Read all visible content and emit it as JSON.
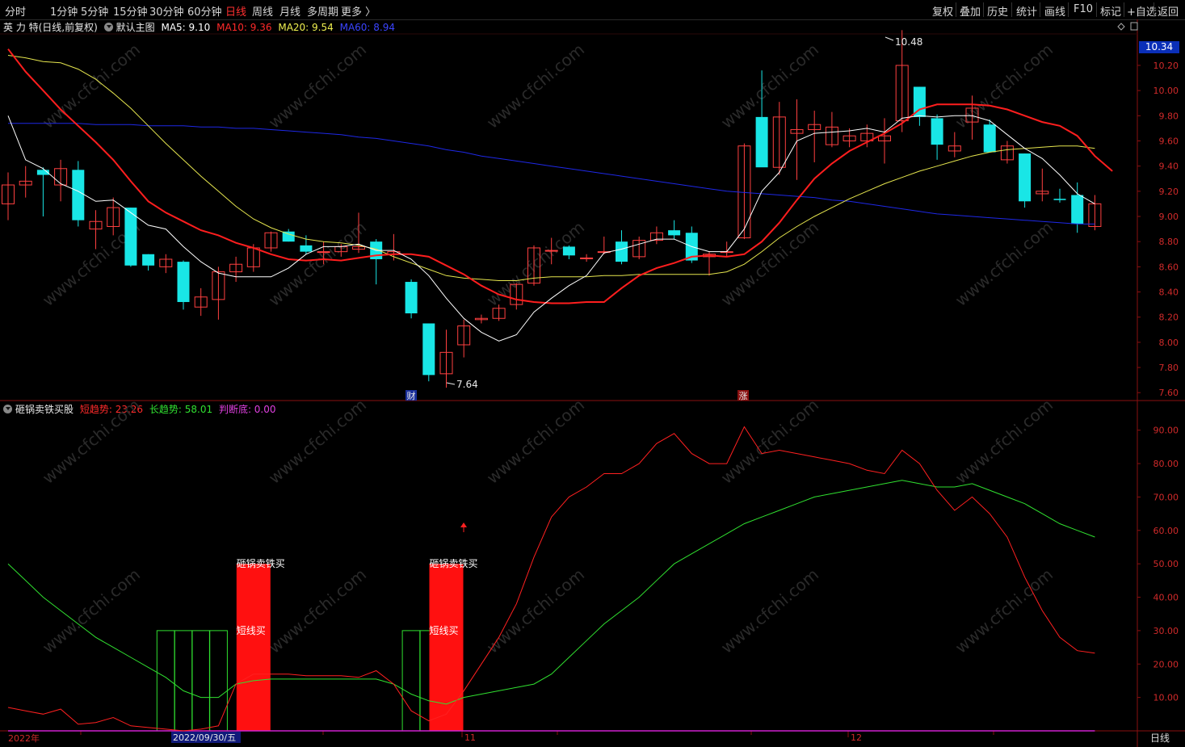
{
  "toolbar": {
    "periods": [
      "分时",
      "1分钟",
      "5分钟",
      "15分钟",
      "30分钟",
      "60分钟",
      "日线",
      "周线",
      "月线",
      "多周期",
      "更多 〉"
    ],
    "active_period": "日线",
    "right_buttons": [
      "复权",
      "叠加",
      "历史",
      "统计",
      "画线",
      "F10",
      "标记",
      "+自选",
      "返回"
    ]
  },
  "main_legend": {
    "stock": "英 力 特(日线,前复权)",
    "template": "默认主图",
    "ma5_label": "MA5: 9.10",
    "ma10_label": "MA10: 9.36",
    "ma20_label": "MA20: 9.54",
    "ma60_label": "MA60: 8.94"
  },
  "indicator_legend": {
    "name": "砸锅卖铁买股",
    "short_label": "短趋势: 23.26",
    "long_label": "长趋势: 58.01",
    "judge_label": "判断底: 0.00"
  },
  "current_price": "10.34",
  "price_axis": [
    "10.20",
    "10.00",
    "9.80",
    "9.60",
    "9.40",
    "9.20",
    "9.00",
    "8.80",
    "8.60",
    "8.40",
    "8.20",
    "8.00",
    "7.80",
    "7.60"
  ],
  "indicator_axis": [
    "90.00",
    "80.00",
    "70.00",
    "60.00",
    "50.00",
    "40.00",
    "30.00",
    "20.00",
    "10.00"
  ],
  "date_axis": {
    "year_label": "2022年",
    "selected_date": "2022/09/30/五",
    "month_11": "11",
    "month_12": "12",
    "period": "日线"
  },
  "annotations": {
    "high": "10.48",
    "low": "7.64",
    "marker_cai": "财",
    "marker_zhang": "涨",
    "signal1_title": "砸锅卖铁买",
    "signal1_sub": "短线买",
    "signal2_title": "砸锅卖铁买",
    "signal2_sub": "短线买",
    "watermark": "www.cfchi.com"
  },
  "colors": {
    "up": "#ff4040",
    "down": "#19e6e6",
    "ma5": "#ffffff",
    "ma10": "#ff1e1e",
    "ma20": "#e6e64e",
    "ma60": "#1e28e6",
    "short_trend": "#ff2020",
    "long_trend": "#30e030",
    "judge": "#d020d0"
  },
  "chart_data": [
    {
      "type": "candlestick",
      "title": "英 力 特(日线,前复权)",
      "ylim": [
        7.55,
        10.45
      ],
      "candles": [
        {
          "o": 9.1,
          "h": 9.35,
          "l": 8.97,
          "c": 9.25
        },
        {
          "o": 9.25,
          "h": 9.4,
          "l": 9.15,
          "c": 9.28
        },
        {
          "o": 9.37,
          "h": 9.39,
          "l": 9.0,
          "c": 9.33
        },
        {
          "o": 9.25,
          "h": 9.45,
          "l": 9.12,
          "c": 9.38
        },
        {
          "o": 9.37,
          "h": 9.44,
          "l": 8.92,
          "c": 8.97
        },
        {
          "o": 8.9,
          "h": 9.05,
          "l": 8.74,
          "c": 8.96
        },
        {
          "o": 8.92,
          "h": 9.15,
          "l": 8.85,
          "c": 9.07
        },
        {
          "o": 9.07,
          "h": 9.07,
          "l": 8.6,
          "c": 8.61
        },
        {
          "o": 8.7,
          "h": 8.7,
          "l": 8.57,
          "c": 8.61
        },
        {
          "o": 8.6,
          "h": 8.7,
          "l": 8.55,
          "c": 8.66
        },
        {
          "o": 8.64,
          "h": 8.65,
          "l": 8.26,
          "c": 8.32
        },
        {
          "o": 8.28,
          "h": 8.43,
          "l": 8.21,
          "c": 8.36
        },
        {
          "o": 8.34,
          "h": 8.6,
          "l": 8.18,
          "c": 8.56
        },
        {
          "o": 8.56,
          "h": 8.68,
          "l": 8.48,
          "c": 8.62
        },
        {
          "o": 8.6,
          "h": 8.78,
          "l": 8.56,
          "c": 8.75
        },
        {
          "o": 8.75,
          "h": 8.88,
          "l": 8.72,
          "c": 8.87
        },
        {
          "o": 8.88,
          "h": 8.9,
          "l": 8.8,
          "c": 8.8
        },
        {
          "o": 8.77,
          "h": 8.85,
          "l": 8.7,
          "c": 8.72
        },
        {
          "o": 8.72,
          "h": 8.8,
          "l": 8.62,
          "c": 8.72
        },
        {
          "o": 8.72,
          "h": 8.78,
          "l": 8.68,
          "c": 8.76
        },
        {
          "o": 8.74,
          "h": 9.03,
          "l": 8.71,
          "c": 8.76
        },
        {
          "o": 8.8,
          "h": 8.82,
          "l": 8.46,
          "c": 8.66
        },
        {
          "o": 8.7,
          "h": 8.86,
          "l": 8.65,
          "c": 8.72
        },
        {
          "o": 8.48,
          "h": 8.5,
          "l": 8.19,
          "c": 8.23
        },
        {
          "o": 8.15,
          "h": 8.15,
          "l": 7.69,
          "c": 7.74
        },
        {
          "o": 7.75,
          "h": 8.1,
          "l": 7.64,
          "c": 7.92
        },
        {
          "o": 7.98,
          "h": 8.18,
          "l": 7.88,
          "c": 8.13
        },
        {
          "o": 8.18,
          "h": 8.22,
          "l": 8.15,
          "c": 8.19
        },
        {
          "o": 8.19,
          "h": 8.3,
          "l": 8.17,
          "c": 8.27
        },
        {
          "o": 8.3,
          "h": 8.47,
          "l": 8.26,
          "c": 8.46
        },
        {
          "o": 8.47,
          "h": 8.77,
          "l": 8.45,
          "c": 8.75
        },
        {
          "o": 8.73,
          "h": 8.83,
          "l": 8.62,
          "c": 8.73
        },
        {
          "o": 8.76,
          "h": 8.77,
          "l": 8.66,
          "c": 8.69
        },
        {
          "o": 8.67,
          "h": 8.7,
          "l": 8.64,
          "c": 8.67
        },
        {
          "o": 8.72,
          "h": 8.84,
          "l": 8.7,
          "c": 8.72
        },
        {
          "o": 8.8,
          "h": 8.89,
          "l": 8.62,
          "c": 8.64
        },
        {
          "o": 8.68,
          "h": 8.84,
          "l": 8.66,
          "c": 8.81
        },
        {
          "o": 8.81,
          "h": 8.92,
          "l": 8.78,
          "c": 8.87
        },
        {
          "o": 8.89,
          "h": 8.97,
          "l": 8.82,
          "c": 8.85
        },
        {
          "o": 8.87,
          "h": 8.92,
          "l": 8.63,
          "c": 8.65
        },
        {
          "o": 8.68,
          "h": 8.72,
          "l": 8.53,
          "c": 8.7
        },
        {
          "o": 8.72,
          "h": 8.8,
          "l": 8.68,
          "c": 8.72
        },
        {
          "o": 8.83,
          "h": 9.58,
          "l": 8.82,
          "c": 9.56
        },
        {
          "o": 9.79,
          "h": 10.16,
          "l": 9.41,
          "c": 9.39
        },
        {
          "o": 9.39,
          "h": 9.91,
          "l": 9.33,
          "c": 9.79
        },
        {
          "o": 9.66,
          "h": 9.93,
          "l": 9.29,
          "c": 9.69
        },
        {
          "o": 9.69,
          "h": 9.84,
          "l": 9.43,
          "c": 9.73
        },
        {
          "o": 9.57,
          "h": 9.83,
          "l": 9.55,
          "c": 9.71
        },
        {
          "o": 9.6,
          "h": 9.7,
          "l": 9.55,
          "c": 9.64
        },
        {
          "o": 9.6,
          "h": 9.73,
          "l": 9.55,
          "c": 9.66
        },
        {
          "o": 9.6,
          "h": 9.78,
          "l": 9.42,
          "c": 9.64
        },
        {
          "o": 9.76,
          "h": 10.48,
          "l": 9.67,
          "c": 10.2
        },
        {
          "o": 10.03,
          "h": 10.03,
          "l": 9.72,
          "c": 9.79
        },
        {
          "o": 9.78,
          "h": 9.81,
          "l": 9.45,
          "c": 9.57
        },
        {
          "o": 9.52,
          "h": 9.67,
          "l": 9.47,
          "c": 9.56
        },
        {
          "o": 9.75,
          "h": 9.96,
          "l": 9.61,
          "c": 9.86
        },
        {
          "o": 9.73,
          "h": 9.77,
          "l": 9.51,
          "c": 9.51
        },
        {
          "o": 9.45,
          "h": 9.6,
          "l": 9.42,
          "c": 9.56
        },
        {
          "o": 9.5,
          "h": 9.5,
          "l": 9.07,
          "c": 9.12
        },
        {
          "o": 9.18,
          "h": 9.38,
          "l": 9.12,
          "c": 9.2
        },
        {
          "o": 9.14,
          "h": 9.22,
          "l": 9.11,
          "c": 9.13
        },
        {
          "o": 9.17,
          "h": 9.27,
          "l": 8.87,
          "c": 8.94
        },
        {
          "o": 8.92,
          "h": 9.17,
          "l": 8.89,
          "c": 9.1
        }
      ],
      "ma5": [
        9.8,
        9.45,
        9.38,
        9.26,
        9.2,
        9.12,
        9.13,
        9.03,
        8.93,
        8.9,
        8.76,
        8.64,
        8.55,
        8.52,
        8.52,
        8.52,
        8.59,
        8.7,
        8.76,
        8.76,
        8.78,
        8.73,
        8.73,
        8.66,
        8.53,
        8.35,
        8.19,
        8.08,
        8.01,
        8.06,
        8.24,
        8.35,
        8.45,
        8.53,
        8.71,
        8.74,
        8.78,
        8.82,
        8.82,
        8.76,
        8.72,
        8.72,
        8.9,
        9.2,
        9.35,
        9.6,
        9.66,
        9.67,
        9.68,
        9.7,
        9.67,
        9.78,
        9.8,
        9.79,
        9.8,
        9.8,
        9.76,
        9.65,
        9.54,
        9.46,
        9.33,
        9.18,
        9.1
      ],
      "ma10": [
        10.33,
        10.15,
        10.0,
        9.85,
        9.72,
        9.59,
        9.45,
        9.28,
        9.12,
        9.03,
        8.96,
        8.89,
        8.85,
        8.79,
        8.75,
        8.7,
        8.66,
        8.65,
        8.66,
        8.65,
        8.67,
        8.69,
        8.7,
        8.7,
        8.68,
        8.61,
        8.54,
        8.45,
        8.38,
        8.34,
        8.32,
        8.31,
        8.31,
        8.32,
        8.32,
        8.43,
        8.53,
        8.59,
        8.63,
        8.68,
        8.69,
        8.68,
        8.7,
        8.8,
        8.95,
        9.13,
        9.3,
        9.42,
        9.52,
        9.59,
        9.66,
        9.74,
        9.85,
        9.89,
        9.89,
        9.89,
        9.88,
        9.85,
        9.8,
        9.75,
        9.72,
        9.64,
        9.48,
        9.36
      ],
      "ma20": [
        10.28,
        10.26,
        10.23,
        10.22,
        10.17,
        10.09,
        9.98,
        9.86,
        9.72,
        9.58,
        9.45,
        9.32,
        9.2,
        9.08,
        8.98,
        8.91,
        8.86,
        8.82,
        8.8,
        8.79,
        8.77,
        8.74,
        8.68,
        8.63,
        8.58,
        8.53,
        8.51,
        8.5,
        8.49,
        8.49,
        8.51,
        8.52,
        8.52,
        8.52,
        8.53,
        8.53,
        8.54,
        8.54,
        8.54,
        8.54,
        8.54,
        8.56,
        8.62,
        8.72,
        8.83,
        8.92,
        9.0,
        9.07,
        9.14,
        9.2,
        9.26,
        9.31,
        9.36,
        9.4,
        9.44,
        9.48,
        9.51,
        9.53,
        9.54,
        9.55,
        9.56,
        9.56,
        9.54
      ],
      "ma60": [
        9.74,
        9.74,
        9.74,
        9.74,
        9.74,
        9.73,
        9.73,
        9.73,
        9.72,
        9.72,
        9.72,
        9.71,
        9.71,
        9.7,
        9.7,
        9.69,
        9.68,
        9.67,
        9.66,
        9.65,
        9.63,
        9.62,
        9.6,
        9.58,
        9.56,
        9.53,
        9.51,
        9.48,
        9.46,
        9.44,
        9.42,
        9.4,
        9.38,
        9.36,
        9.34,
        9.32,
        9.3,
        9.28,
        9.26,
        9.24,
        9.22,
        9.2,
        9.19,
        9.18,
        9.17,
        9.16,
        9.15,
        9.13,
        9.12,
        9.1,
        9.08,
        9.06,
        9.04,
        9.02,
        9.01,
        9.0,
        8.99,
        8.98,
        8.97,
        8.96,
        8.95,
        8.94,
        8.94
      ]
    },
    {
      "type": "line",
      "title": "砸锅卖铁买股",
      "ylim": [
        0,
        95
      ],
      "series": [
        {
          "name": "短趋势",
          "values": [
            7,
            6,
            5,
            6.5,
            2,
            2.5,
            4,
            1.5,
            1,
            0.5,
            0,
            0.5,
            1.5,
            14,
            17,
            17,
            17,
            16.5,
            16.5,
            16.5,
            16,
            18,
            14,
            6,
            3,
            5,
            12,
            20,
            28,
            38,
            52,
            64,
            70,
            73,
            77,
            77,
            80,
            86,
            89,
            83,
            80,
            80,
            91,
            83,
            84,
            83,
            82,
            81,
            80,
            78,
            77,
            84,
            80,
            72,
            66,
            70,
            65,
            58,
            46,
            36,
            28,
            24,
            23.26
          ]
        },
        {
          "name": "长趋势",
          "values": [
            50,
            45,
            40,
            36,
            32,
            28,
            25,
            22,
            19,
            16,
            12,
            10,
            10,
            14,
            15,
            15.5,
            15.5,
            15.5,
            15.5,
            15.5,
            15.5,
            15.5,
            14,
            11,
            9,
            8,
            10,
            11,
            12,
            13,
            14,
            17,
            22,
            27,
            32,
            36,
            40,
            45,
            50,
            53,
            56,
            59,
            62,
            64,
            66,
            68,
            70,
            71,
            72,
            73,
            74,
            75,
            74,
            73,
            73,
            74,
            72,
            70,
            68,
            65,
            62,
            60,
            58.01
          ]
        },
        {
          "name": "判断底",
          "values": [
            0,
            0,
            0,
            0,
            0,
            0,
            0,
            0,
            0,
            0,
            0,
            0,
            0,
            0,
            0,
            0,
            0,
            0,
            0,
            0,
            0,
            0,
            0,
            0,
            0,
            0,
            0,
            0,
            0,
            0,
            0,
            0,
            0,
            0,
            0,
            0,
            0,
            0,
            0,
            0,
            0,
            0,
            0,
            0,
            0,
            0,
            0,
            0,
            0,
            0,
            0,
            0,
            0,
            0,
            0,
            0,
            0,
            0,
            0,
            0,
            0,
            0,
            0
          ]
        }
      ],
      "signals": [
        {
          "idx": [
            9,
            10,
            11,
            12
          ],
          "value": 30,
          "kind": "outline"
        },
        {
          "idx": [
            14
          ],
          "value": 50,
          "kind": "buy"
        },
        {
          "idx": [
            23,
            24
          ],
          "value": 30,
          "kind": "outline"
        },
        {
          "idx": [
            25
          ],
          "value": 50,
          "kind": "buy"
        }
      ]
    }
  ]
}
